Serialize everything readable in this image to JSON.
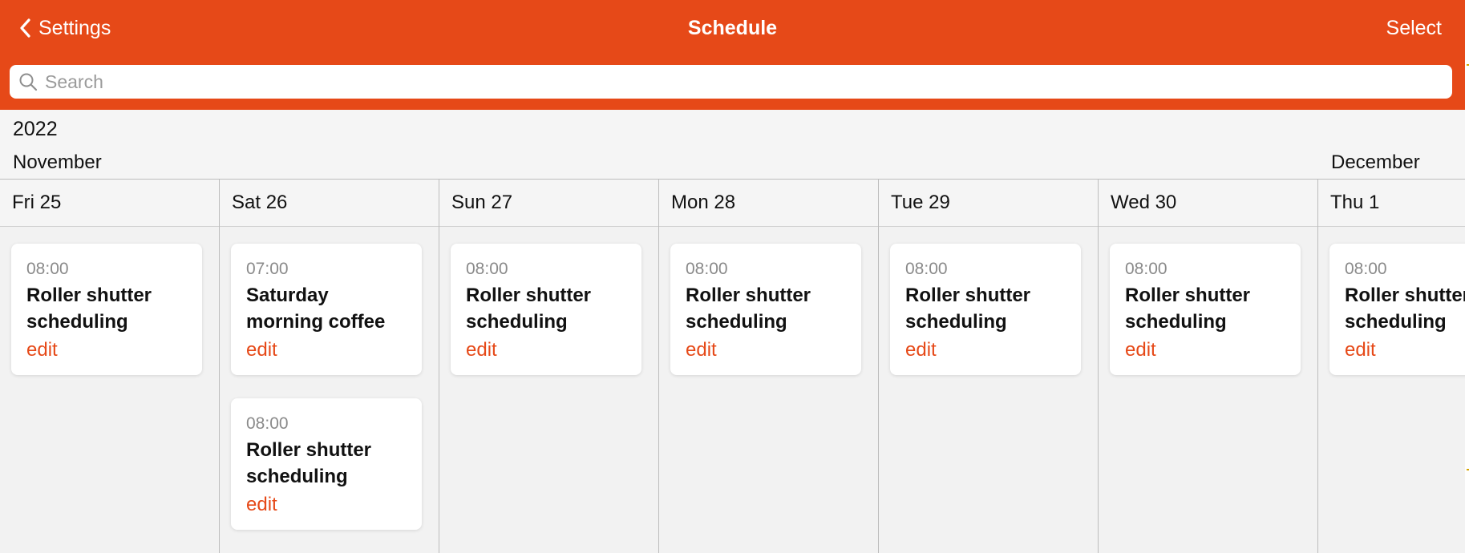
{
  "header": {
    "back_label": "Settings",
    "title": "Schedule",
    "select_label": "Select",
    "bg_color": "#e64918"
  },
  "search": {
    "placeholder": "Search"
  },
  "calendar": {
    "year": "2022",
    "months": [
      "November",
      "December"
    ],
    "days": [
      {
        "label": "Fri 25",
        "events": [
          {
            "time": "08:00",
            "title": "Roller shutter scheduling",
            "action": "edit"
          }
        ]
      },
      {
        "label": "Sat 26",
        "events": [
          {
            "time": "07:00",
            "title": "Saturday morning coffee",
            "action": "edit"
          },
          {
            "time": "08:00",
            "title": "Roller shutter scheduling",
            "action": "edit"
          }
        ]
      },
      {
        "label": "Sun 27",
        "events": [
          {
            "time": "08:00",
            "title": "Roller shutter scheduling",
            "action": "edit"
          }
        ]
      },
      {
        "label": "Mon 28",
        "events": [
          {
            "time": "08:00",
            "title": "Roller shutter scheduling",
            "action": "edit"
          }
        ]
      },
      {
        "label": "Tue 29",
        "events": [
          {
            "time": "08:00",
            "title": "Roller shutter scheduling",
            "action": "edit"
          }
        ]
      },
      {
        "label": "Wed 30",
        "events": [
          {
            "time": "08:00",
            "title": "Roller shutter scheduling",
            "action": "edit"
          }
        ]
      },
      {
        "label": "Thu 1",
        "events": [
          {
            "time": "08:00",
            "title": "Roller shutter scheduling",
            "action": "edit"
          }
        ]
      }
    ]
  },
  "icons": {
    "back": "chevron-left-icon",
    "search": "search-icon"
  },
  "colors": {
    "accent": "#e64918",
    "background": "#f2f2f2",
    "card": "#ffffff"
  }
}
